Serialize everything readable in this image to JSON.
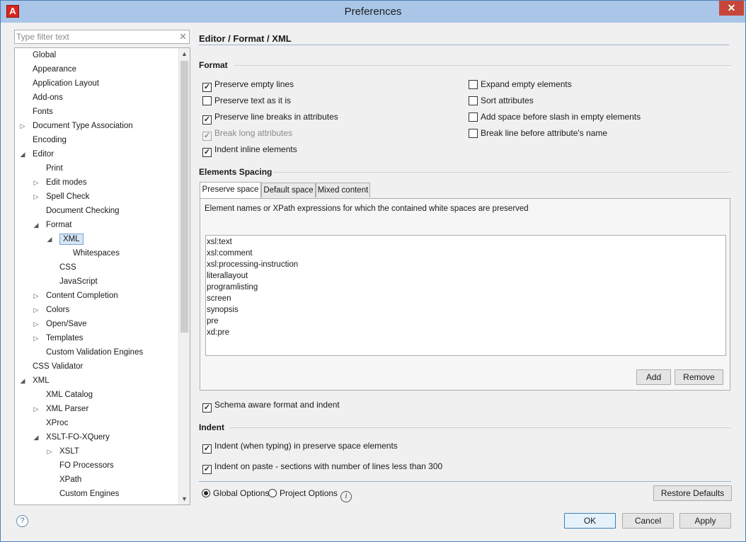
{
  "window": {
    "title": "Preferences",
    "close_label": "✕",
    "app_icon_letter": "A"
  },
  "filter": {
    "placeholder": "Type filter text",
    "clear_glyph": "✕"
  },
  "tree": {
    "items": [
      {
        "label": "Global",
        "level": 0,
        "arrow": ""
      },
      {
        "label": "Appearance",
        "level": 0,
        "arrow": ""
      },
      {
        "label": "Application Layout",
        "level": 0,
        "arrow": ""
      },
      {
        "label": "Add-ons",
        "level": 0,
        "arrow": ""
      },
      {
        "label": "Fonts",
        "level": 0,
        "arrow": ""
      },
      {
        "label": "Document Type Association",
        "level": 0,
        "arrow": "▷"
      },
      {
        "label": "Encoding",
        "level": 0,
        "arrow": ""
      },
      {
        "label": "Editor",
        "level": 0,
        "arrow": "◢"
      },
      {
        "label": "Print",
        "level": 1,
        "arrow": ""
      },
      {
        "label": "Edit modes",
        "level": 1,
        "arrow": "▷"
      },
      {
        "label": "Spell Check",
        "level": 1,
        "arrow": "▷"
      },
      {
        "label": "Document Checking",
        "level": 1,
        "arrow": ""
      },
      {
        "label": "Format",
        "level": 1,
        "arrow": "◢"
      },
      {
        "label": "XML",
        "level": 2,
        "arrow": "◢",
        "selected": true
      },
      {
        "label": "Whitespaces",
        "level": 3,
        "arrow": ""
      },
      {
        "label": "CSS",
        "level": 2,
        "arrow": ""
      },
      {
        "label": "JavaScript",
        "level": 2,
        "arrow": ""
      },
      {
        "label": "Content Completion",
        "level": 1,
        "arrow": "▷"
      },
      {
        "label": "Colors",
        "level": 1,
        "arrow": "▷"
      },
      {
        "label": "Open/Save",
        "level": 1,
        "arrow": "▷"
      },
      {
        "label": "Templates",
        "level": 1,
        "arrow": "▷"
      },
      {
        "label": "Custom Validation Engines",
        "level": 1,
        "arrow": ""
      },
      {
        "label": "CSS Validator",
        "level": 0,
        "arrow": ""
      },
      {
        "label": "XML",
        "level": 0,
        "arrow": "◢"
      },
      {
        "label": "XML Catalog",
        "level": 1,
        "arrow": ""
      },
      {
        "label": "XML Parser",
        "level": 1,
        "arrow": "▷"
      },
      {
        "label": "XProc",
        "level": 1,
        "arrow": ""
      },
      {
        "label": "XSLT-FO-XQuery",
        "level": 1,
        "arrow": "◢"
      },
      {
        "label": "XSLT",
        "level": 2,
        "arrow": "▷"
      },
      {
        "label": "FO Processors",
        "level": 2,
        "arrow": ""
      },
      {
        "label": "XPath",
        "level": 2,
        "arrow": ""
      },
      {
        "label": "Custom Engines",
        "level": 2,
        "arrow": ""
      }
    ],
    "scroll_up": "▲",
    "scroll_down": "▼"
  },
  "header": {
    "breadcrumb": "Editor / Format / XML"
  },
  "format": {
    "title": "Format",
    "left": [
      {
        "label": "Preserve empty lines",
        "checked": true,
        "disabled": false
      },
      {
        "label": "Preserve text as it is",
        "checked": false,
        "disabled": false
      },
      {
        "label": "Preserve line breaks in attributes",
        "checked": true,
        "disabled": false
      },
      {
        "label": "Break long attributes",
        "checked": true,
        "disabled": true
      },
      {
        "label": "Indent inline elements",
        "checked": true,
        "disabled": false
      }
    ],
    "right": [
      {
        "label": "Expand empty elements",
        "checked": false
      },
      {
        "label": "Sort attributes",
        "checked": false
      },
      {
        "label": "Add space before slash in empty elements",
        "checked": false
      },
      {
        "label": "Break line before attribute's name",
        "checked": false
      }
    ]
  },
  "spacing": {
    "title": "Elements Spacing",
    "tabs": [
      "Preserve space",
      "Default space",
      "Mixed content"
    ],
    "description": "Element names or XPath expressions for which the contained white spaces are preserved",
    "list": [
      "xsl:text",
      "xsl:comment",
      "xsl:processing-instruction",
      "literallayout",
      "programlisting",
      "screen",
      "synopsis",
      "pre",
      "xd:pre"
    ],
    "add_label": "Add",
    "remove_label": "Remove"
  },
  "schema_aware": {
    "label": "Schema aware format and indent",
    "checked": true
  },
  "indent": {
    "title": "Indent",
    "options": [
      {
        "label": "Indent (when typing) in preserve space elements",
        "checked": true
      },
      {
        "label": "Indent on paste - sections with number of lines less than 300",
        "checked": true
      }
    ]
  },
  "scope": {
    "global_label": "Global Options",
    "project_label": "Project Options",
    "selected": "global",
    "info_glyph": "i",
    "restore_label": "Restore Defaults"
  },
  "footer": {
    "help_glyph": "?",
    "ok_label": "OK",
    "cancel_label": "Cancel",
    "apply_label": "Apply"
  }
}
